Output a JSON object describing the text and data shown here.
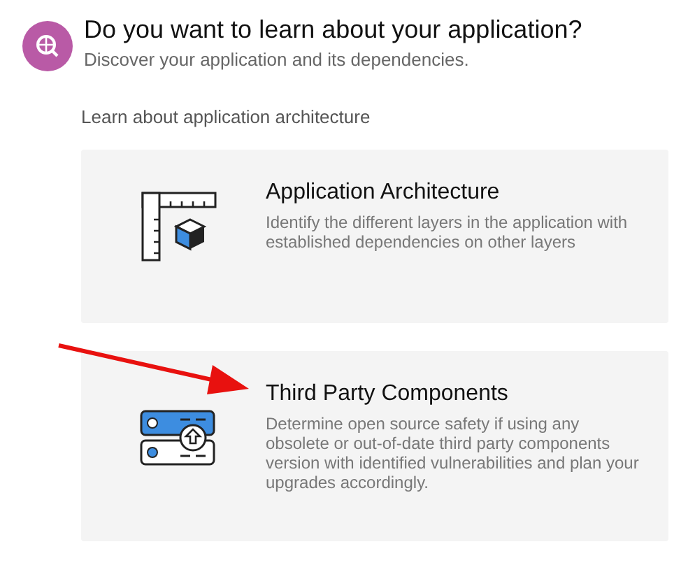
{
  "header": {
    "title": "Do you want to learn about your application?",
    "subtitle": "Discover your application and its dependencies."
  },
  "section_label": "Learn about application architecture",
  "cards": [
    {
      "kind": "architecture",
      "title": "Application Architecture",
      "description": "Identify the different layers in the application with established dependencies on other layers"
    },
    {
      "kind": "components",
      "title": "Third Party Components",
      "description": "Determine open source safety if using any obsolete or out-of-date third party components version with identified vulnerabilities and plan your upgrades accordingly."
    }
  ],
  "annotation": {
    "kind": "arrow",
    "color": "#e8110f"
  }
}
